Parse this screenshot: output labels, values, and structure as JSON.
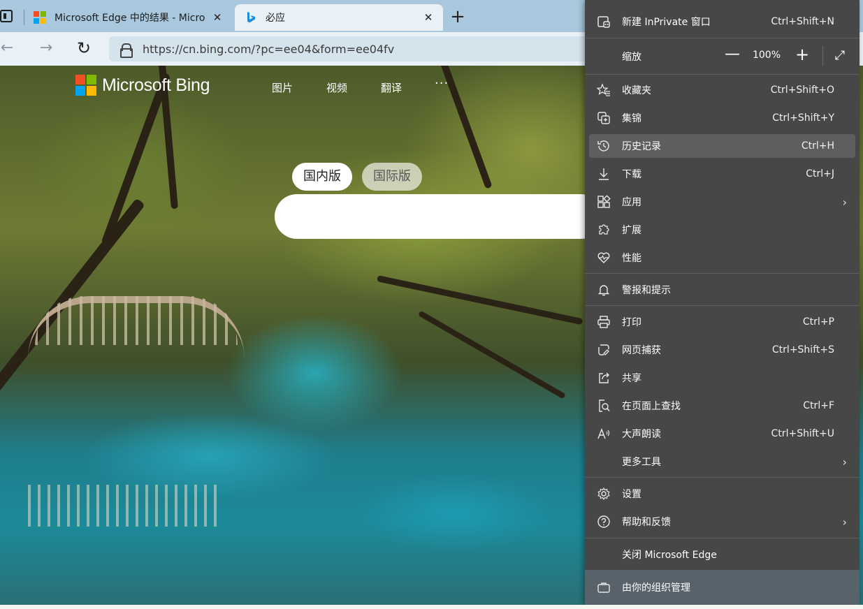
{
  "tabs": [
    {
      "title": "Microsoft Edge 中的结果 - Micro",
      "close": "✕"
    },
    {
      "title": "必应",
      "close": "✕"
    }
  ],
  "new_tab": "+",
  "toolbar": {
    "back": "←",
    "forward": "→",
    "reload": "↻",
    "url": "https://cn.bing.com/?pc=ee04&form=ee04fv"
  },
  "page": {
    "logo_text": "Microsoft Bing",
    "logo_colors": [
      "#f25022",
      "#7fba00",
      "#00a4ef",
      "#ffb900"
    ],
    "nav": [
      "图片",
      "视频",
      "翻译",
      "···"
    ],
    "pills": [
      "国内版",
      "国际版"
    ]
  },
  "menu": {
    "inprivate": {
      "label": "新建 InPrivate 窗口",
      "shortcut": "Ctrl+Shift+N",
      "icon": "inprivate-window-icon"
    },
    "zoom": {
      "label": "缩放",
      "minus": "—",
      "value": "100%",
      "plus": "+",
      "fullscreen": "⤢"
    },
    "favorites": {
      "label": "收藏夹",
      "shortcut": "Ctrl+Shift+O",
      "icon": "favorites-star-icon"
    },
    "collections": {
      "label": "集锦",
      "shortcut": "Ctrl+Shift+Y",
      "icon": "collections-icon"
    },
    "history": {
      "label": "历史记录",
      "shortcut": "Ctrl+H",
      "icon": "history-icon"
    },
    "downloads": {
      "label": "下载",
      "shortcut": "Ctrl+J",
      "icon": "download-icon"
    },
    "apps": {
      "label": "应用",
      "chevron": "›",
      "icon": "apps-icon"
    },
    "extensions": {
      "label": "扩展",
      "icon": "extensions-puzzle-icon"
    },
    "performance": {
      "label": "性能",
      "icon": "performance-heart-icon"
    },
    "alerts": {
      "label": "警报和提示",
      "icon": "bell-icon"
    },
    "print": {
      "label": "打印",
      "shortcut": "Ctrl+P",
      "icon": "printer-icon"
    },
    "capture": {
      "label": "网页捕获",
      "shortcut": "Ctrl+Shift+S",
      "icon": "web-capture-icon"
    },
    "share": {
      "label": "共享",
      "icon": "share-icon"
    },
    "find": {
      "label": "在页面上查找",
      "shortcut": "Ctrl+F",
      "icon": "find-on-page-icon"
    },
    "read_aloud": {
      "label": "大声朗读",
      "shortcut": "Ctrl+Shift+U",
      "icon": "read-aloud-icon"
    },
    "more_tools": {
      "label": "更多工具",
      "chevron": "›"
    },
    "settings": {
      "label": "设置",
      "icon": "gear-icon"
    },
    "help": {
      "label": "帮助和反馈",
      "chevron": "›",
      "icon": "help-icon"
    },
    "close_edge": {
      "label": "关闭 Microsoft Edge"
    },
    "org": {
      "label": "由你的组织管理",
      "icon": "briefcase-icon"
    }
  }
}
